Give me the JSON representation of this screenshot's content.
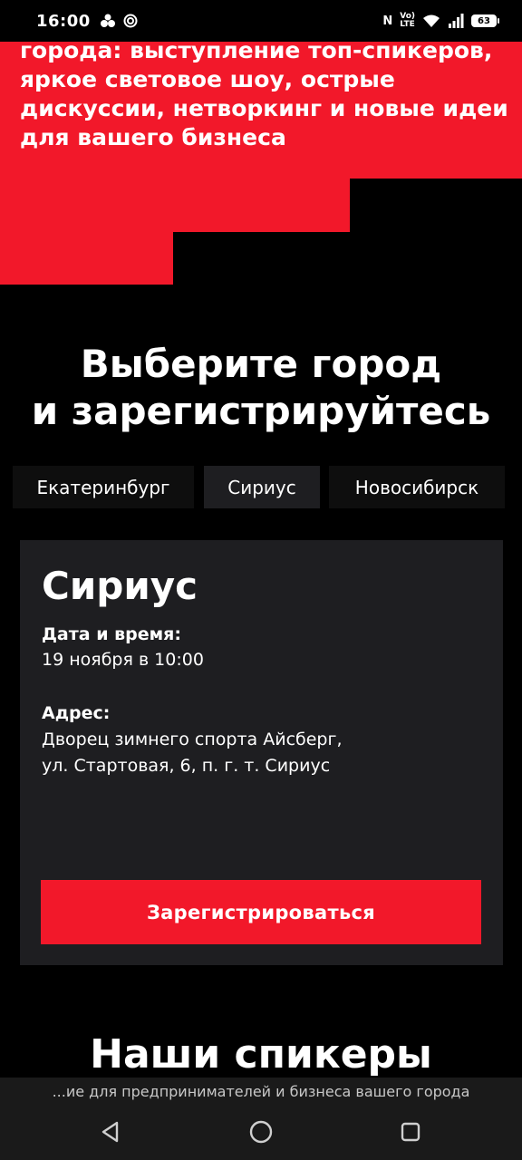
{
  "status_bar": {
    "time": "16:00",
    "network_text_top": "Vo)",
    "network_text_bottom": "LTE",
    "battery": "63",
    "nfc_glyph": "N"
  },
  "hero": {
    "text": "города: выступление топ-спикеров, яркое световое шоу, острые дискуссии, нетворкинг и новые идеи для вашего бизнеса",
    "accent_color": "#f2182a"
  },
  "city_section": {
    "title_line1": "Выберите город",
    "title_line2": "и зарегистрируйтесь",
    "tabs": [
      {
        "label": "Екатеринбург",
        "selected": false
      },
      {
        "label": "Сириус",
        "selected": true
      },
      {
        "label": "Новосибирск",
        "selected": false
      }
    ]
  },
  "event_card": {
    "city": "Сириус",
    "datetime_label": "Дата и время:",
    "datetime_value": "19 ноября в 10:00",
    "address_label": "Адрес:",
    "address_line1": "Дворец зимнего спорта Айсберг,",
    "address_line2": "ул. Стартовая, 6, п. г. т. Сириус",
    "register_label": "Зарегистрироваться"
  },
  "speakers": {
    "title": "Наши спикеры"
  },
  "browser": {
    "url_text": "...ие для предпринимателей и бизнеса вашего города"
  },
  "nav": {
    "back": "back-icon",
    "home": "home-icon",
    "recent": "recent-apps-icon"
  }
}
